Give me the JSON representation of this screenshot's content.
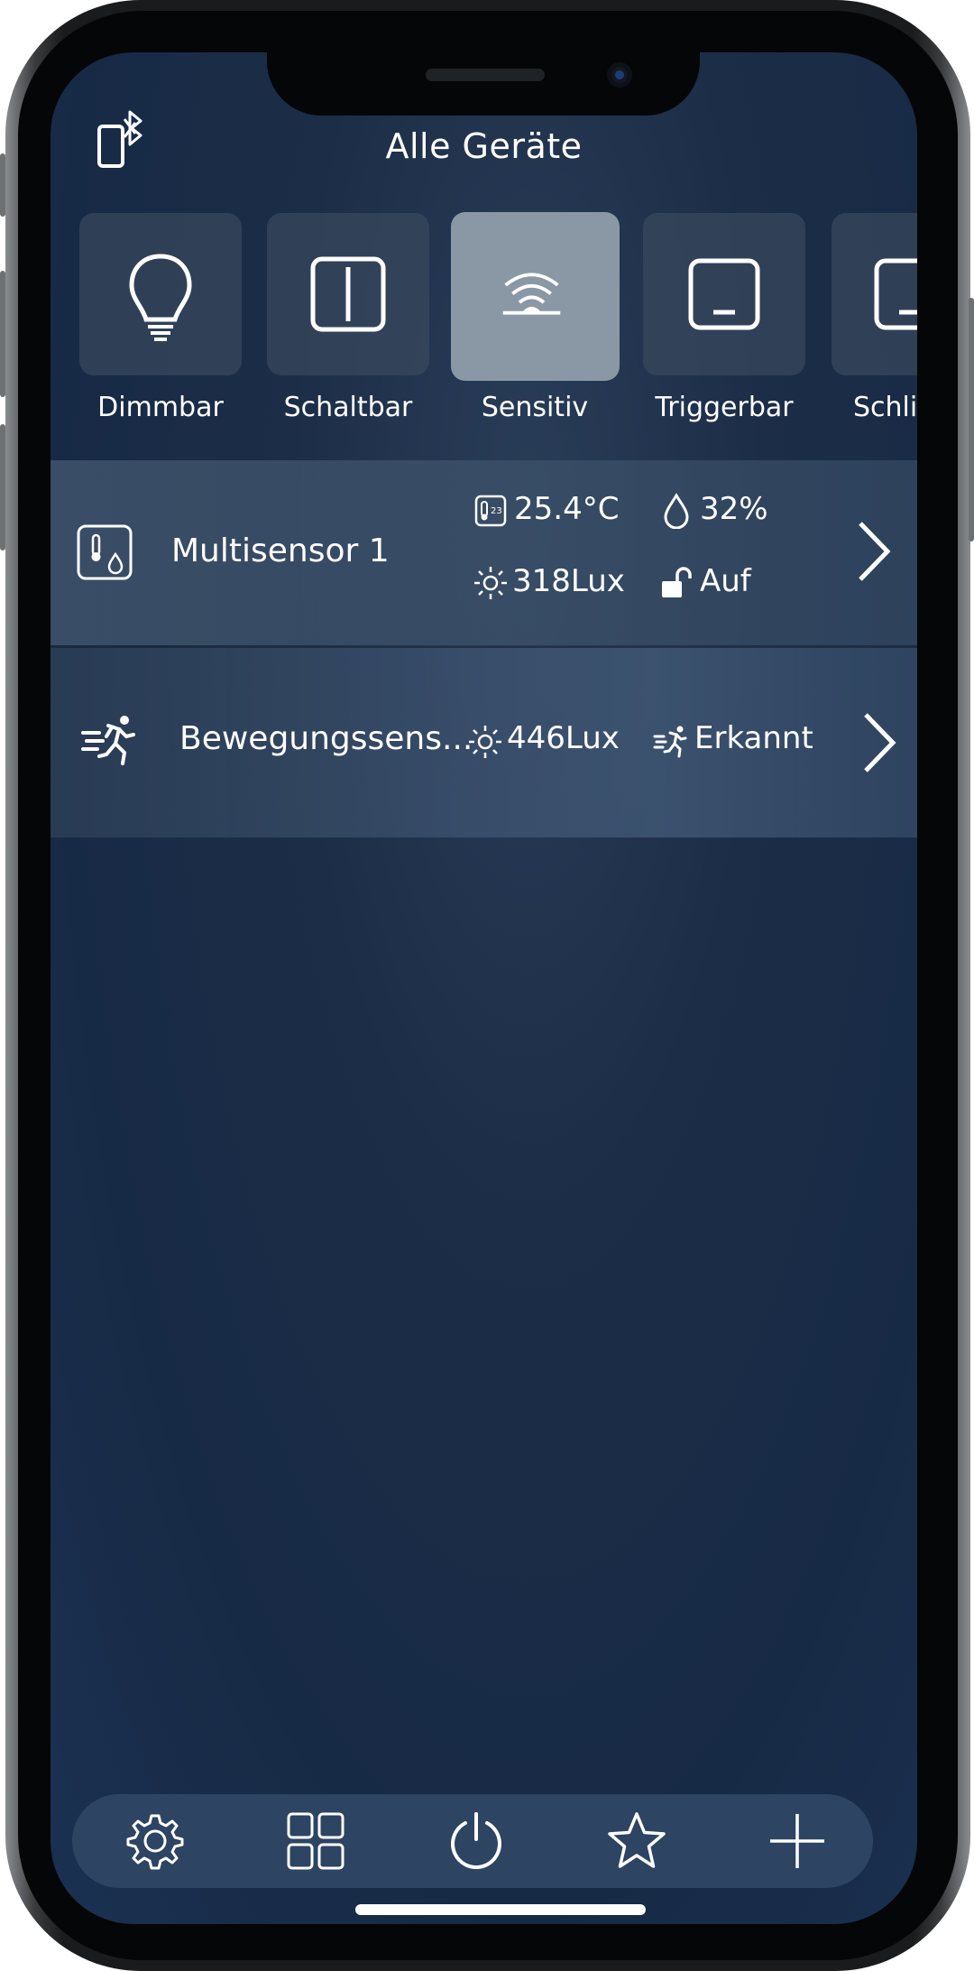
{
  "header": {
    "title": "Alle Geräte",
    "bluetooth_icon": "phone-bluetooth-icon"
  },
  "categories": [
    {
      "label": "Dimmbar",
      "icon": "lightbulb-icon",
      "active": false
    },
    {
      "label": "Schaltbar",
      "icon": "switch-icon",
      "active": false
    },
    {
      "label": "Sensitiv",
      "icon": "sensor-wave-icon",
      "active": true
    },
    {
      "label": "Triggerbar",
      "icon": "trigger-button-icon",
      "active": false
    },
    {
      "label": "Schli",
      "icon": "trigger-button-icon",
      "active": false
    }
  ],
  "devices": [
    {
      "name": "Multisensor 1",
      "icon": "thermometer-drop-icon",
      "temperature": "25.4°C",
      "humidity": "32%",
      "lux": "318Lux",
      "lock_state": "Auf"
    },
    {
      "name": "Bewegungssens...",
      "icon": "running-person-icon",
      "lux": "446Lux",
      "motion": "Erkannt"
    }
  ],
  "tabbar": [
    "gear-icon",
    "grid-icon",
    "power-icon",
    "star-icon",
    "plus-icon"
  ],
  "colors": {
    "background": "#1c2d47",
    "active_category": "#8a98a6",
    "text": "#ffffff"
  }
}
